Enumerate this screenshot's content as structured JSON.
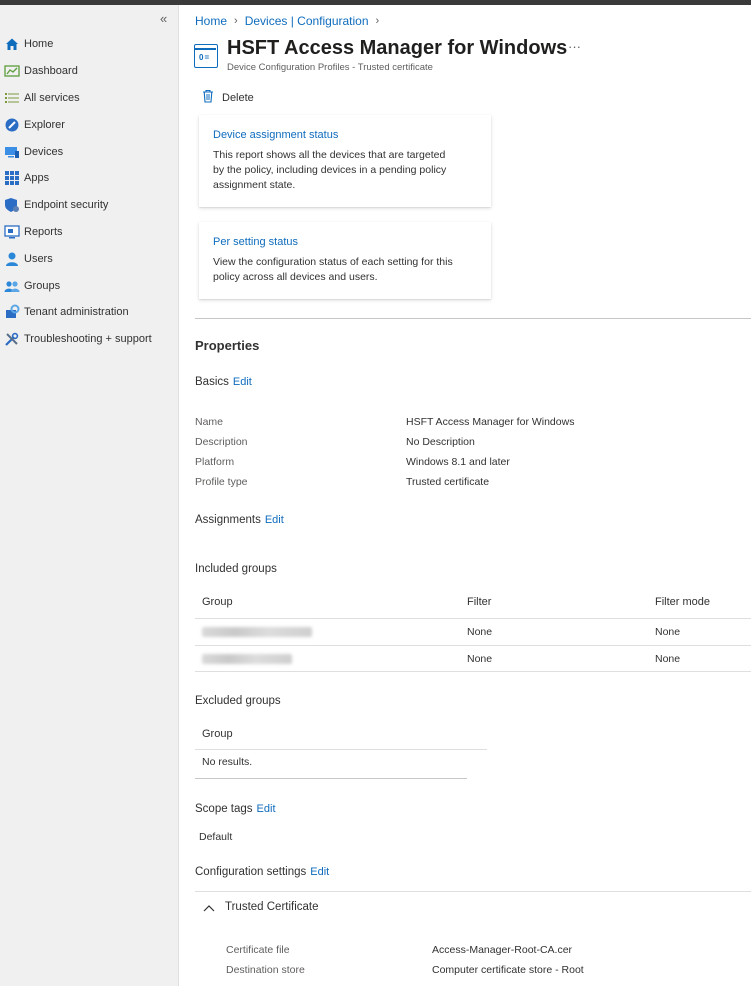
{
  "sidebar": {
    "collapse_icon": "«",
    "items": [
      {
        "label": "Home",
        "icon": "home-icon"
      },
      {
        "label": "Dashboard",
        "icon": "dashboard-icon"
      },
      {
        "label": "All services",
        "icon": "list-icon"
      },
      {
        "label": "Explorer",
        "icon": "explorer-icon"
      },
      {
        "label": "Devices",
        "icon": "devices-icon"
      },
      {
        "label": "Apps",
        "icon": "apps-icon"
      },
      {
        "label": "Endpoint security",
        "icon": "shield-icon"
      },
      {
        "label": "Reports",
        "icon": "reports-icon"
      },
      {
        "label": "Users",
        "icon": "user-icon"
      },
      {
        "label": "Groups",
        "icon": "groups-icon"
      },
      {
        "label": "Tenant administration",
        "icon": "gear-icon"
      },
      {
        "label": "Troubleshooting + support",
        "icon": "tools-icon"
      }
    ]
  },
  "breadcrumb": {
    "home": "Home",
    "devices": "Devices | Configuration"
  },
  "header": {
    "title": "HSFT Access Manager for Windows",
    "subtitle": "Device Configuration Profiles - Trusted certificate",
    "more": "···"
  },
  "toolbar": {
    "delete_label": "Delete"
  },
  "cards": [
    {
      "title": "Device assignment status",
      "desc": "This report shows all the devices that are targeted by the policy, including devices in a pending policy assignment state."
    },
    {
      "title": "Per setting status",
      "desc": "View the configuration status of each setting for this policy across all devices and users."
    }
  ],
  "properties": {
    "heading": "Properties",
    "basics": {
      "label": "Basics",
      "edit": "Edit",
      "rows": [
        {
          "key": "Name",
          "value": "HSFT Access Manager for Windows"
        },
        {
          "key": "Description",
          "value": "No Description"
        },
        {
          "key": "Platform",
          "value": "Windows 8.1 and later"
        },
        {
          "key": "Profile type",
          "value": "Trusted certificate"
        }
      ]
    },
    "assignments": {
      "label": "Assignments",
      "edit": "Edit"
    },
    "included": {
      "label": "Included groups",
      "columns": [
        "Group",
        "Filter",
        "Filter mode"
      ],
      "rows": [
        {
          "filter": "None",
          "mode": "None"
        },
        {
          "filter": "None",
          "mode": "None"
        }
      ]
    },
    "excluded": {
      "label": "Excluded groups",
      "column": "Group",
      "empty": "No results."
    },
    "scope": {
      "label": "Scope tags",
      "edit": "Edit",
      "value": "Default"
    },
    "config": {
      "label": "Configuration settings",
      "edit": "Edit",
      "section": "Trusted Certificate",
      "rows": [
        {
          "key": "Certificate file",
          "value": "Access-Manager-Root-CA.cer"
        },
        {
          "key": "Destination store",
          "value": "Computer certificate store - Root"
        }
      ]
    }
  },
  "colors": {
    "accent": "#0f6cbd",
    "sidebar_bg": "#f0f0f0"
  }
}
